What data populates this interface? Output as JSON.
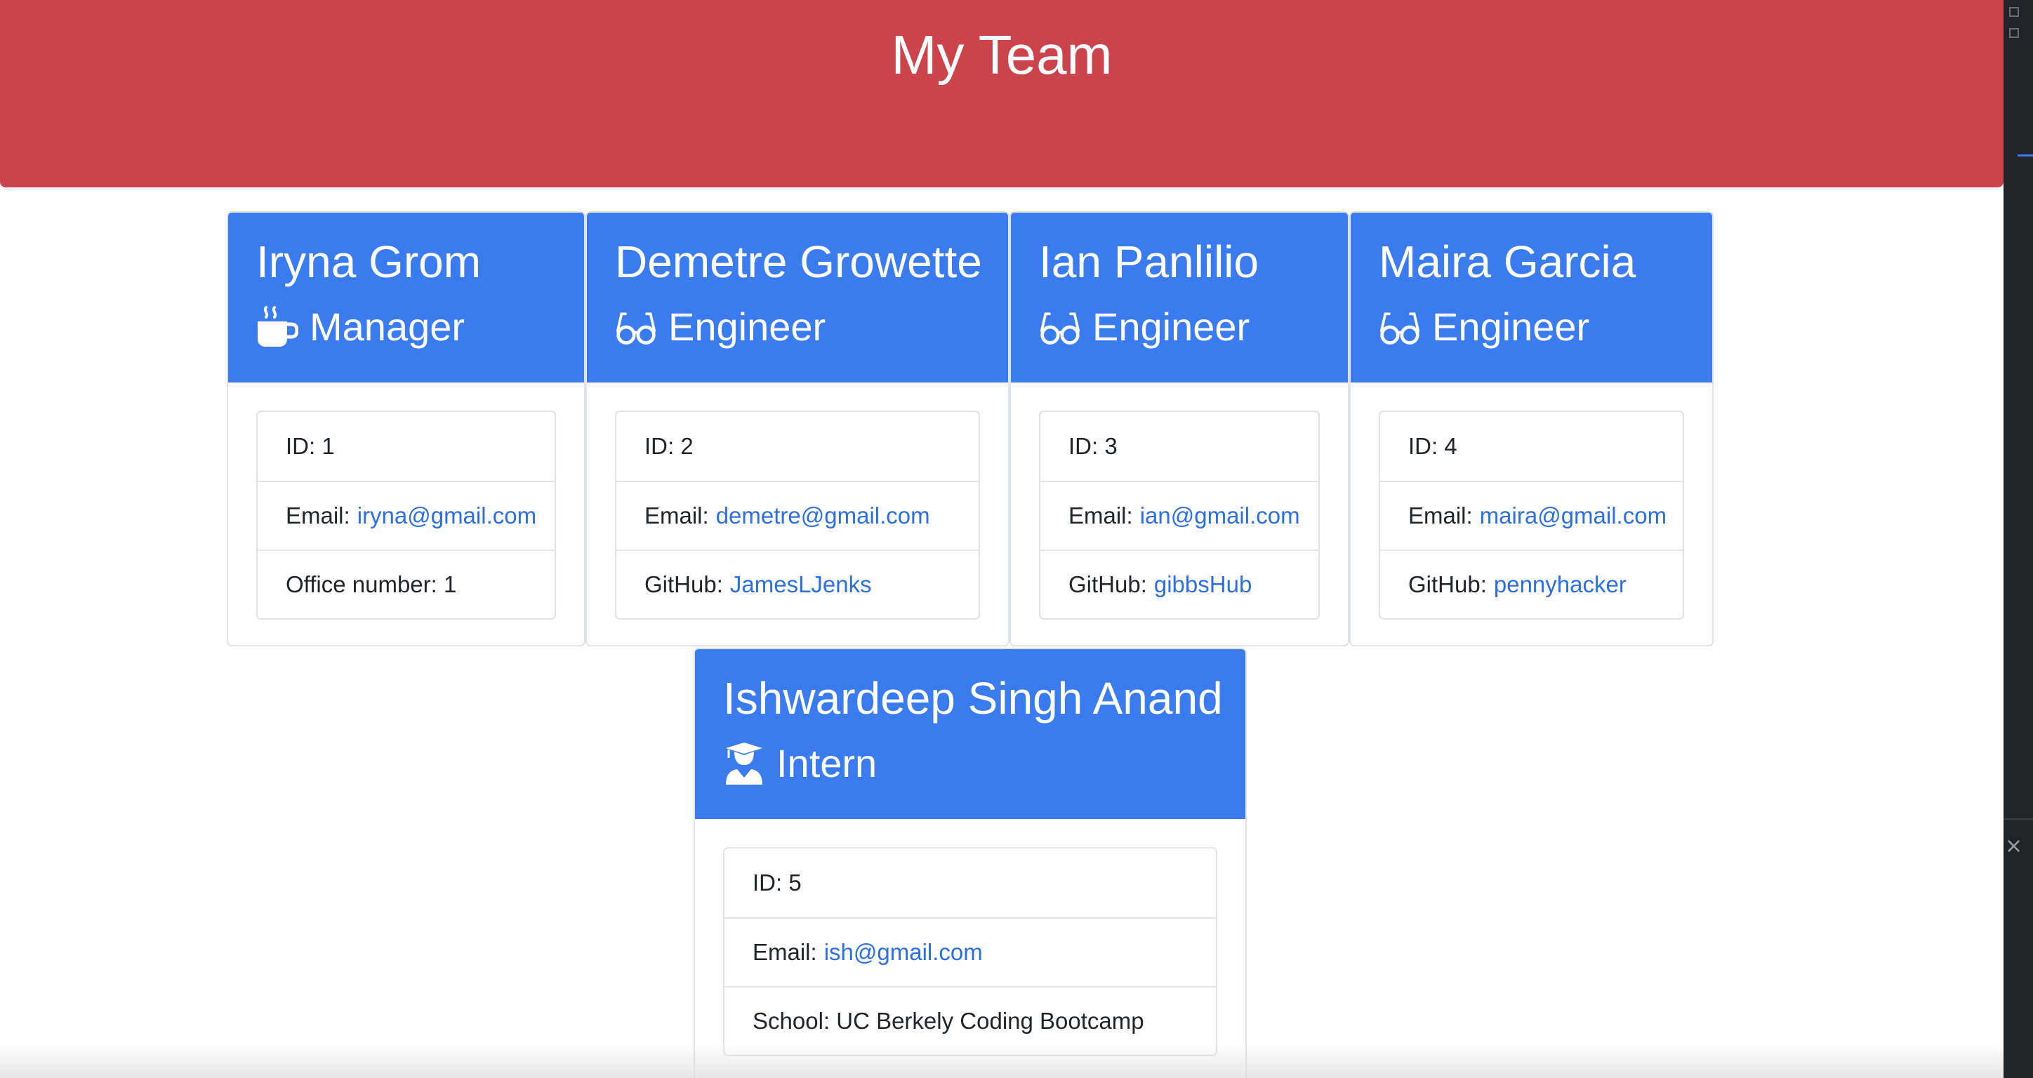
{
  "page": {
    "title": "My Team"
  },
  "team": [
    {
      "name": "Iryna Grom",
      "role": "Manager",
      "icon": "coffee-icon",
      "id_label": "ID: 1",
      "email_label": "Email:",
      "email": "iryna@gmail.com",
      "extra_label": "Office number: 1",
      "extra_link": ""
    },
    {
      "name": "Demetre Growette",
      "role": "Engineer",
      "icon": "glasses-icon",
      "id_label": "ID: 2",
      "email_label": "Email:",
      "email": "demetre@gmail.com",
      "extra_label": "GitHub:",
      "extra_link": "JamesLJenks"
    },
    {
      "name": "Ian Panlilio",
      "role": "Engineer",
      "icon": "glasses-icon",
      "id_label": "ID: 3",
      "email_label": "Email:",
      "email": "ian@gmail.com",
      "extra_label": "GitHub:",
      "extra_link": "gibbsHub"
    },
    {
      "name": "Maira Garcia",
      "role": "Engineer",
      "icon": "glasses-icon",
      "id_label": "ID: 4",
      "email_label": "Email:",
      "email": "maira@gmail.com",
      "extra_label": "GitHub:",
      "extra_link": "pennyhacker"
    },
    {
      "name": "Ishwardeep Singh Anand",
      "role": "Intern",
      "icon": "graduate-icon",
      "id_label": "ID: 5",
      "email_label": "Email:",
      "email": "ish@gmail.com",
      "extra_label": "School: UC Berkely Coding Bootcamp",
      "extra_link": ""
    }
  ],
  "colors": {
    "jumbotron": "#cb444c",
    "card_header": "#3a7bf0",
    "link": "#2d6fe0",
    "border": "#dfe2e6"
  }
}
